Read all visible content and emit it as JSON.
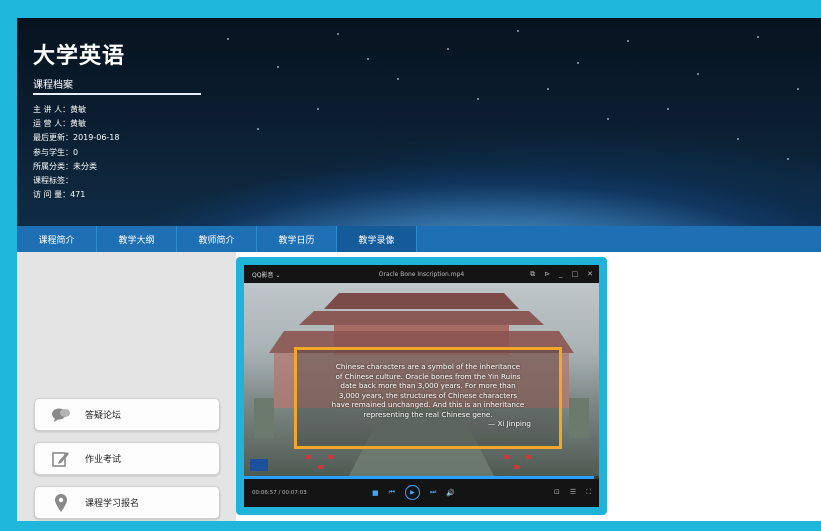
{
  "course": {
    "title": "大学英语",
    "subtitle": "课程档案",
    "info": [
      "主 讲 人：黄敏",
      "运 营 人：黄敏",
      "最后更新：2019-06-18",
      "参与学生：0",
      "所属分类：未分类",
      "课程标签：",
      "访 问 量：471"
    ]
  },
  "nav": {
    "items": [
      "课程简介",
      "教学大纲",
      "教师简介",
      "教学日历",
      "教学录像"
    ],
    "active_index": 4
  },
  "sidebar": {
    "items": [
      {
        "label": "答疑论坛",
        "icon": "chat-bubbles-icon"
      },
      {
        "label": "作业考试",
        "icon": "edit-note-icon"
      },
      {
        "label": "课程学习报名",
        "icon": "map-pin-icon"
      }
    ]
  },
  "player": {
    "brand": "QQ影音 ⌄",
    "filename": "Oracle Bone Inscription.mp4",
    "window_controls": [
      "⧉",
      "⊳",
      "_",
      "□",
      "✕"
    ],
    "subtitle_lines": [
      "Chinese characters are a symbol of the inheritance",
      "of Chinese culture. Oracle bones from the Yin Ruins",
      "date back more than 3,000 years. For more than",
      "3,000 years, the structures of Chinese characters",
      "have remained unchanged. And this is an inheritance",
      "representing the real Chinese gene."
    ],
    "subtitle_author": "— Xi Jinping",
    "time": "00:06:57 / 00:07:03",
    "progress": 0.985,
    "controls": [
      "■",
      "⏮",
      "▶",
      "⏭",
      "🔊"
    ],
    "right_controls": [
      "⊡",
      "☰",
      "⛶"
    ],
    "watermark": "CCTV"
  }
}
